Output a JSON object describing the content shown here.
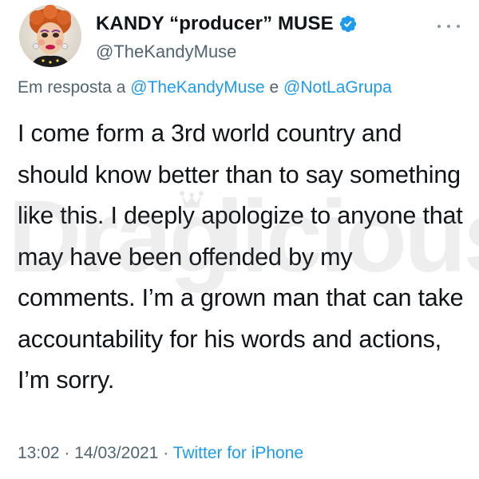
{
  "tweet": {
    "author": {
      "display_name": "KANDY “producer” MUSE",
      "handle": "@TheKandyMuse",
      "verified": true
    },
    "reply_context": {
      "prefix": "Em resposta a",
      "mention_1": "@TheKandyMuse",
      "conjunction": "e",
      "mention_2": "@NotLaGrupa"
    },
    "text": "I come form a 3rd world country and should know better than to say something like this. I deeply apologize to anyone that may have been offended by my comments. I’m a grown man that can take accountability for his words and actions, I’m sorry.",
    "meta": {
      "time": "13:02",
      "separator": "·",
      "date": "14/03/2021",
      "source": "Twitter for iPhone"
    }
  },
  "watermark": {
    "text": "Dragalicious"
  },
  "colors": {
    "accent": "#1d9bf0",
    "secondary_text": "#536471",
    "primary_text": "#0f1419"
  },
  "icons": {
    "verified": "verified-badge-icon",
    "more": "more-options-icon"
  }
}
